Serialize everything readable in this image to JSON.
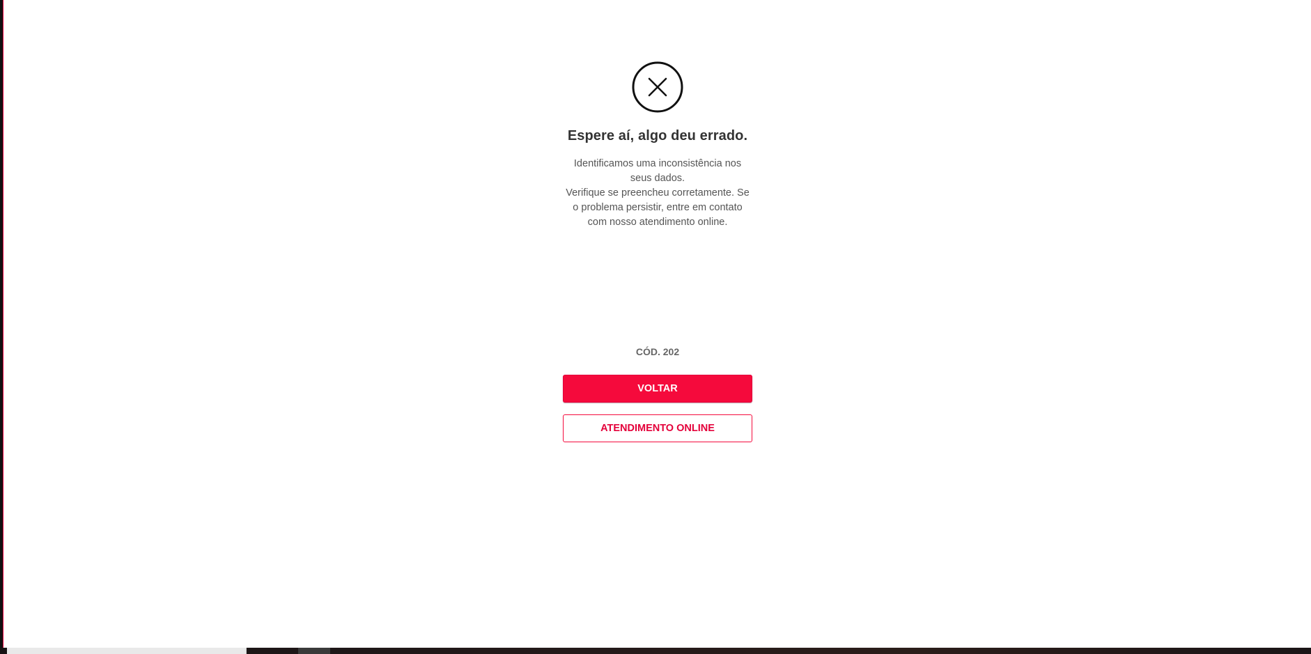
{
  "error": {
    "icon": "close-circle-icon",
    "title": "Espere aí, algo deu errado.",
    "message_line_1": "Identificamos uma inconsistência nos seus dados.",
    "message_line_2": "Verifique se preencheu corretamente. Se o problema persistir, entre em contato com nosso atendimento online.",
    "code": "CÓD. 202"
  },
  "actions": {
    "back_label": "VOLTAR",
    "support_label": "ATENDIMENTO ONLINE"
  },
  "colors": {
    "accent": "#f50a3c",
    "accent_dark": "#e4003a",
    "text_primary": "#333333",
    "text_secondary": "#555555"
  }
}
